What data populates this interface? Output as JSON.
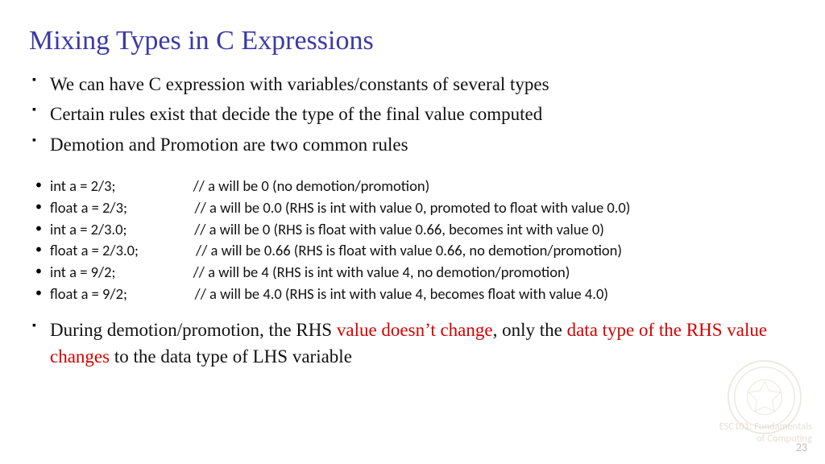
{
  "title": "Mixing Types in C Expressions",
  "main_bullets": [
    "We can have C expression with variables/constants of several types",
    "Certain rules exist that decide the type of the final value computed",
    "Demotion and Promotion are two common rules"
  ],
  "code_bullets": [
    "int a = 2/3;                       // a will be 0 (no demotion/promotion)",
    "float a = 2/3;                    // a will be 0.0 (RHS is int with value 0, promoted to float with value 0.0)",
    "int a = 2/3.0;                    // a will be 0 (RHS is float with value 0.66, becomes int with value 0)",
    "float a = 2/3.0;                 // a will be 0.66 (RHS is float with value 0.66, no demotion/promotion)",
    "int a = 9/2;                       // a will be 4 (RHS is int with value 4, no demotion/promotion)",
    "float a = 9/2;                    // a will be 4.0 (RHS is int with value 4, becomes float with value 4.0)"
  ],
  "closing_bullet": {
    "pre": "During demotion/promotion, the RHS ",
    "red1": "value doesn’t change",
    "mid": ", only the ",
    "red2": "data type of the RHS value changes",
    "post": " to the data type of LHS variable"
  },
  "page_number": "23",
  "watermark_line1": "ESC101: Fundamentals",
  "watermark_line2": "of Computing"
}
